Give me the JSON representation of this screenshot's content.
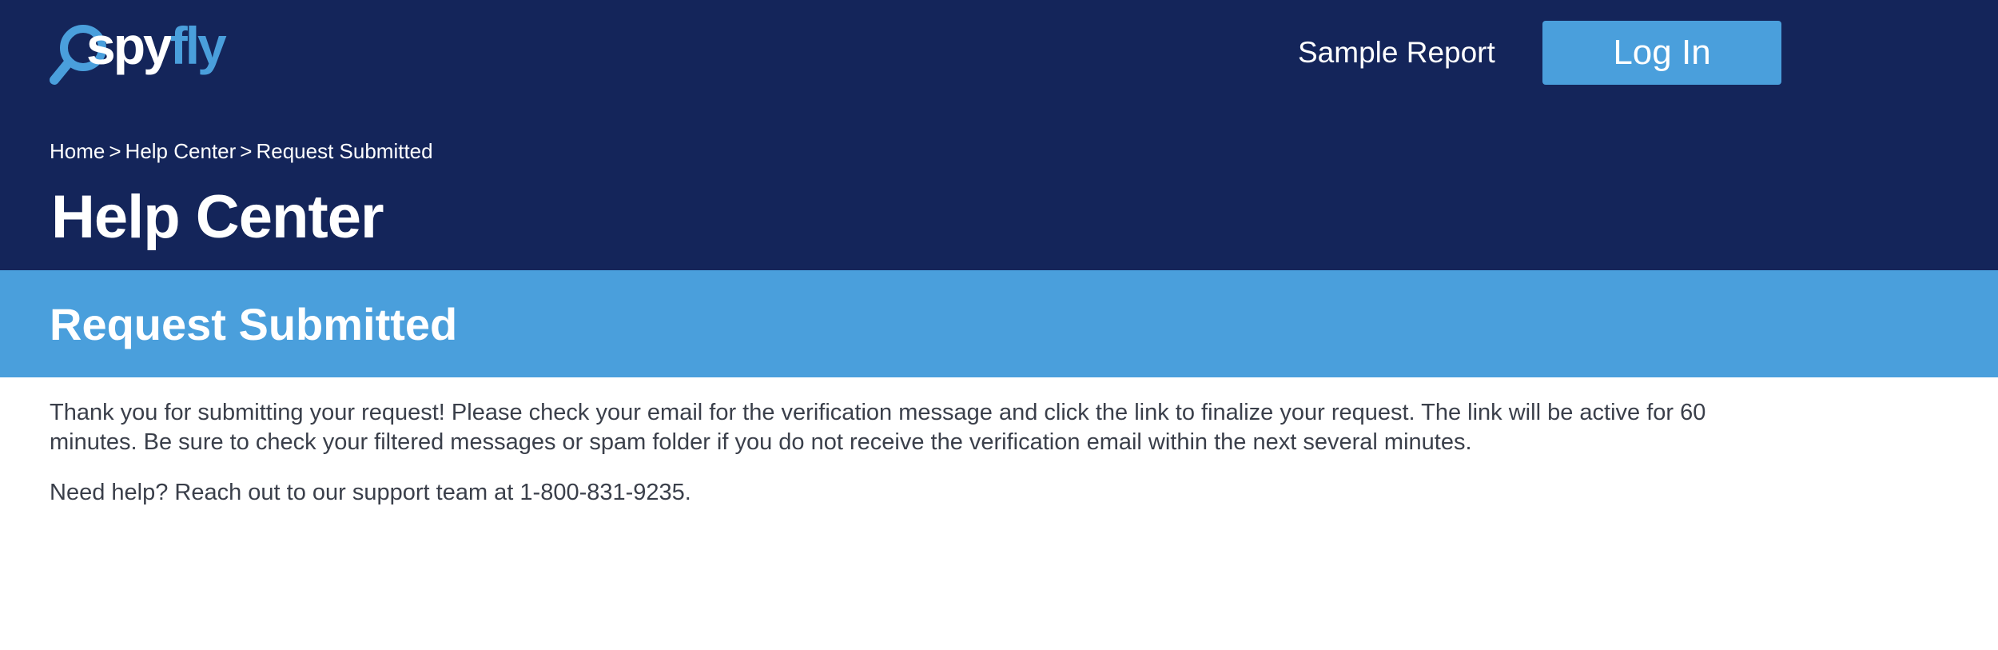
{
  "brand": {
    "logo_part1": "spy",
    "logo_part2": "fly",
    "colors": {
      "navy": "#14255a",
      "accent": "#4a9fdc",
      "text": "#3a3f4a"
    }
  },
  "nav": {
    "sample_report": "Sample Report",
    "login": "Log In"
  },
  "breadcrumb": {
    "items": [
      "Home",
      "Help Center",
      "Request Submitted"
    ],
    "separator": ">"
  },
  "header": {
    "title": "Help Center"
  },
  "banner": {
    "title": "Request Submitted"
  },
  "main": {
    "paragraph1": "Thank you for submitting your request! Please check your email for the verification message and click the link to finalize your request. The link will be active for 60 minutes. Be sure to check your filtered messages or spam folder if you do not receive the verification email within the next several minutes.",
    "paragraph2": "Need help? Reach out to our support team at 1-800-831-9235."
  },
  "icons": {
    "logo_icon": "magnifier-icon"
  }
}
